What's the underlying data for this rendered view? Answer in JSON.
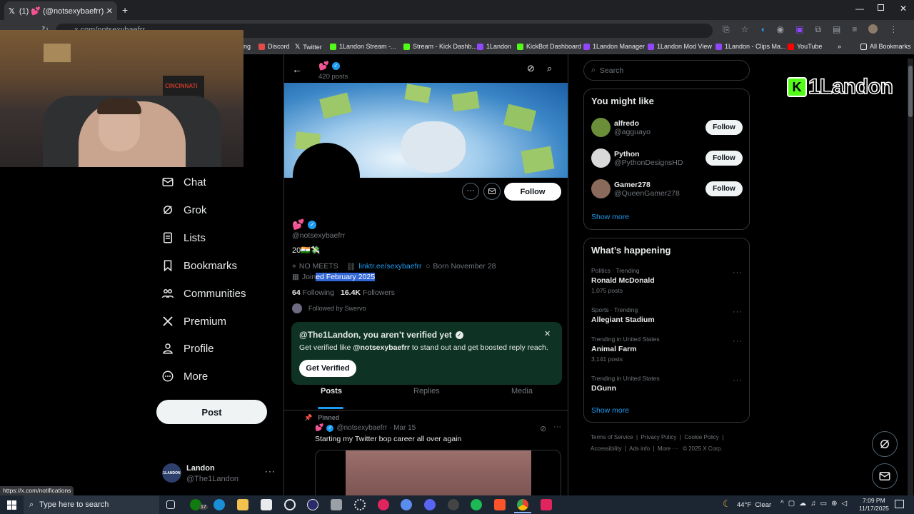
{
  "browser": {
    "tab_title": "(1) 💕 (@notsexybaefrr) / X",
    "url": "x.com/notsexybaefrr",
    "bookmarks": [
      "ng",
      "Discord",
      "Twitter",
      "1Landon Stream -...",
      "Stream - Kick Dashb...",
      "1Landon",
      "KickBot Dashboard",
      "1Landon Manager",
      "1Landon Mod View",
      "1Landon - Clips Ma...",
      "YouTube"
    ],
    "all_bookmarks": "All Bookmarks",
    "status_url": "https://x.com/notifications"
  },
  "webcam": {
    "banner_text": "CINCINNATI"
  },
  "nav": {
    "items": [
      "Chat",
      "Grok",
      "Lists",
      "Bookmarks",
      "Communities",
      "Premium",
      "Profile",
      "More"
    ],
    "post_label": "Post"
  },
  "account": {
    "name": "Landon",
    "handle": "@The1Landon",
    "avatar_text": "1LANDON"
  },
  "profile": {
    "header_posts": "420 posts",
    "display_name": "💕",
    "handle": "@notsexybaefrr",
    "bio": "20🇮🇳💸",
    "location": "NO MEETS",
    "link": "linktr.ee/sexybaefrr",
    "born": "Born November 28",
    "joined_prefix": "Join",
    "joined_highlight": "ed February 2025",
    "following_count": "64",
    "following_label": "Following",
    "followers_count": "16.4K",
    "followers_label": "Followers",
    "followed_by": "Followed by Swervo",
    "follow_label": "Follow"
  },
  "verify_banner": {
    "title": "@The1Landon, you aren’t verified yet",
    "text_prefix": "Get verified like ",
    "text_handle": "@notsexybaefrr",
    "text_suffix": " to stand out and get boosted reply reach.",
    "button": "Get Verified"
  },
  "tabs": [
    "Posts",
    "Replies",
    "Media"
  ],
  "pinned_post": {
    "pinned_label": "Pinned",
    "meta": "@notsexybaefrr · Mar 15",
    "text": "Starting my Twitter bop career all over again"
  },
  "search": {
    "placeholder": "Search"
  },
  "you_might_like": {
    "title": "You might like",
    "users": [
      {
        "name": "alfredo",
        "handle": "@agguayo",
        "avatar_color": "#6b8e3a"
      },
      {
        "name": "Python",
        "handle": "@PythonDesignsHD",
        "avatar_color": "#d9d9d9"
      },
      {
        "name": "Gamer278",
        "handle": "@QueenGamer278",
        "avatar_color": "#8a6a5a"
      }
    ],
    "follow_label": "Follow",
    "show_more": "Show more"
  },
  "whats_happening": {
    "title": "What’s happening",
    "trends": [
      {
        "category": "Politics · Trending",
        "name": "Ronald McDonald",
        "posts": "1,075 posts"
      },
      {
        "category": "Sports · Trending",
        "name": "Allegiant Stadium",
        "posts": ""
      },
      {
        "category": "Trending in United States",
        "name": "Animal Farm",
        "posts": "3,141 posts"
      },
      {
        "category": "Trending in United States",
        "name": "DGunn",
        "posts": ""
      }
    ],
    "show_more": "Show more"
  },
  "footer": {
    "links": [
      "Terms of Service",
      "Privacy Policy",
      "Cookie Policy",
      "Accessibility",
      "Ads info",
      "More ···",
      "© 2025 X Corp."
    ]
  },
  "overlay": {
    "logo_text": "1Landon"
  },
  "taskbar": {
    "search_placeholder": "Type here to search",
    "weather": "44°F  Clear",
    "time": "7:09 PM",
    "date": "11/17/2025",
    "badge": "17"
  },
  "colors": {
    "accent": "#1d9bf0",
    "verify_bg": "#0e3324",
    "kick_green": "#53fc18"
  }
}
